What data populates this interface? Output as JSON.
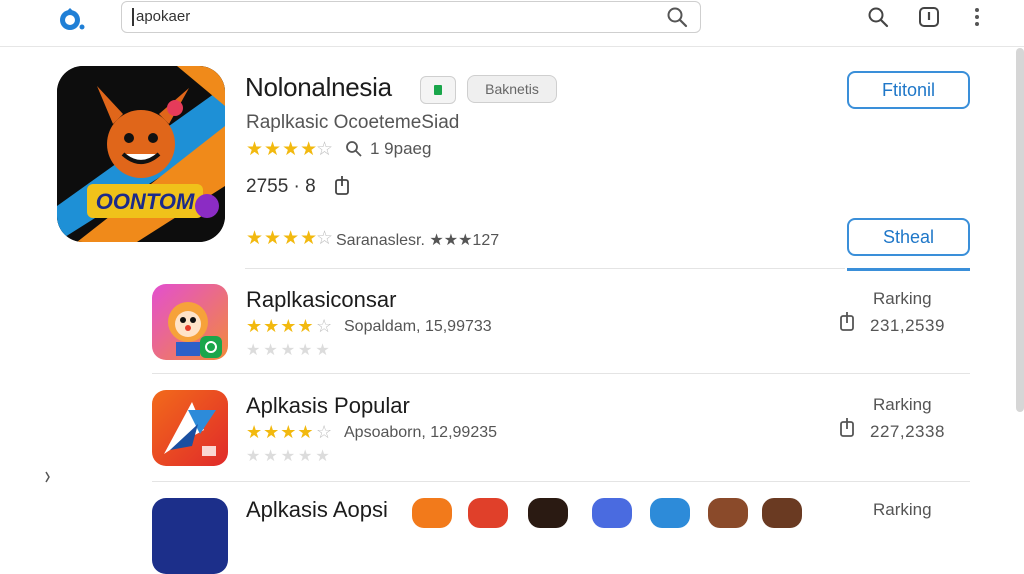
{
  "search": {
    "value": "apokaer"
  },
  "featured": {
    "title": "Nolonalnesia",
    "chip_label": "Baknetis",
    "subtitle": "Raplkasic OcoetemeSiad",
    "stars": "★★★★",
    "stars_empty": "☆",
    "meta1": "1 9paeg",
    "count": "2755 · 8",
    "stars2": "★★★★",
    "stars2_empty": "☆",
    "meta2": "Saranaslesr. ★★★127",
    "icon_text": "OONTOM",
    "primary_button": "Ftitonil",
    "secondary_button": "Stheal"
  },
  "apps": [
    {
      "name": "Raplkasiconsar",
      "stars": "★★★★",
      "stars_empty": "☆",
      "meta": "Sopaldam, 15,99733",
      "gray_stars": "★★★★★",
      "rank_label": "Rarking",
      "rank_value": "231,2539"
    },
    {
      "name": "Aplkasis Popular",
      "stars": "★★★★",
      "stars_empty": "☆",
      "meta": "Apsoaborn, 12,99235",
      "gray_stars": "★★★★★",
      "rank_label": "Rarking",
      "rank_value": "227,2338"
    },
    {
      "name": "Aplkasis Aopsi",
      "rank_label": "Rarking"
    }
  ],
  "colors": {
    "accent": "#3a8fd9",
    "star": "#f2b90f",
    "green": "#1aa64b"
  },
  "icons": [
    "logo-icon",
    "search-icon",
    "info-icon",
    "more-icon",
    "share-icon"
  ]
}
